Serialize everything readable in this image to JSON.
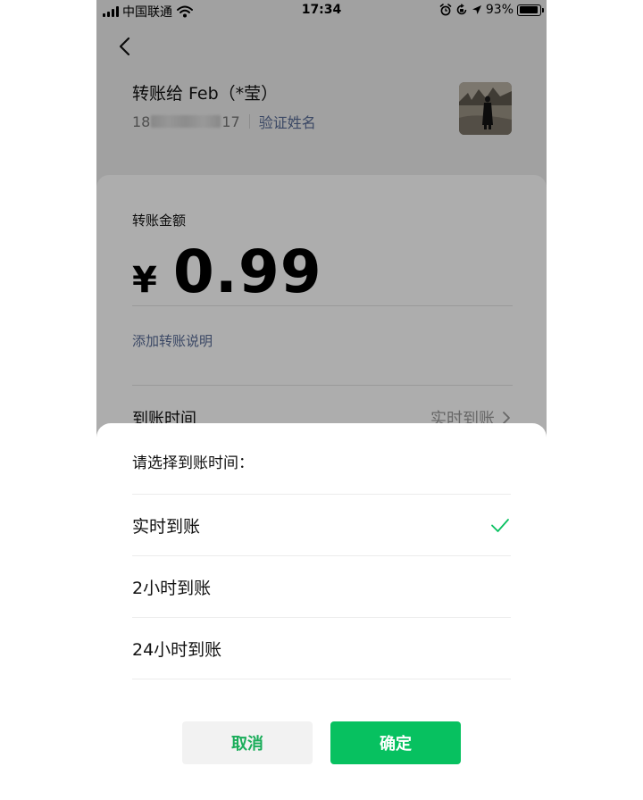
{
  "status_bar": {
    "carrier": "中国联通",
    "time": "17:34",
    "battery": "93%",
    "battery_level": 0.93,
    "icons": [
      "signal-bars-icon",
      "wifi-icon",
      "alarm-icon",
      "orientation-lock-icon",
      "location-icon",
      "battery-icon"
    ]
  },
  "header": {
    "back_icon": "chevron-left-icon",
    "recipient_title": "转账给 Feb（*莹）",
    "phone_prefix": "18",
    "phone_suffix": "17",
    "verify_name_link": "验证姓名",
    "avatar": "recipient-avatar-photo"
  },
  "transfer": {
    "amount_label": "转账金额",
    "currency_symbol": "¥",
    "amount": "0.99",
    "add_note_link": "添加转账说明",
    "arrival_time_label": "到账时间",
    "arrival_time_value": "实时到账"
  },
  "sheet": {
    "title": "请选择到账时间：",
    "options": [
      {
        "label": "实时到账",
        "selected": true
      },
      {
        "label": "2小时到账",
        "selected": false
      },
      {
        "label": "24小时到账",
        "selected": false
      }
    ],
    "cancel_label": "取消",
    "confirm_label": "确定"
  },
  "colors": {
    "accent_green": "#07c160",
    "link_blue": "#576b95",
    "overlay": "rgba(0,0,0,0.32)"
  }
}
